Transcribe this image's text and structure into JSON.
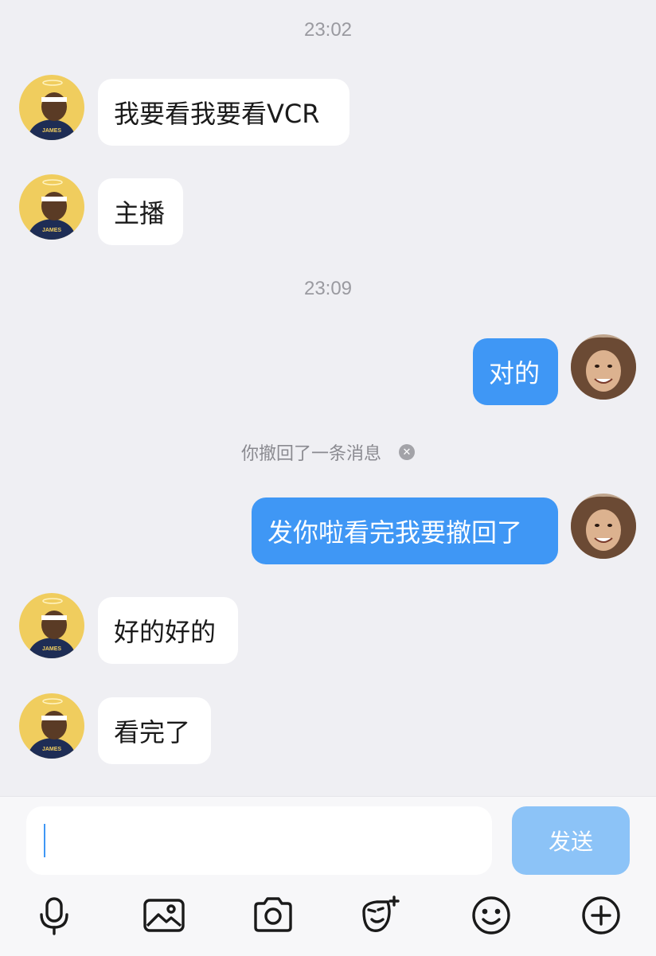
{
  "messages_meta": {
    "time_1": "23:02",
    "time_2": "23:09"
  },
  "messages": {
    "m1": "我要看我要看VCR",
    "m2": "主播",
    "m3": "对的",
    "m4": "发你啦看完我要撤回了",
    "m5": "好的好的",
    "m6": "看完了"
  },
  "recall_notice": "你撤回了一条消息",
  "avatars": {
    "contact_jersey_text": "JAMES"
  },
  "input": {
    "value": "",
    "send_label": "发送"
  },
  "toolbar": {
    "icons": [
      "microphone-icon",
      "image-icon",
      "camera-icon",
      "sticker-icon",
      "emoji-icon",
      "plus-icon"
    ]
  },
  "colors": {
    "background": "#efeff3",
    "outgoing_bubble": "#3f97f5",
    "incoming_bubble": "#ffffff",
    "send_button": "#8cc3f7"
  }
}
